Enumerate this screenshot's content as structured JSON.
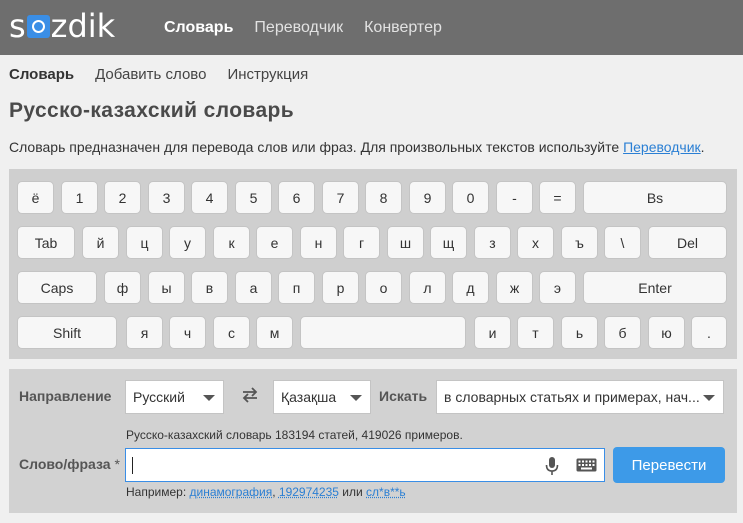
{
  "header": {
    "logo_text": "sozdik",
    "nav": [
      "Словарь",
      "Переводчик",
      "Конвертер"
    ]
  },
  "subnav": [
    "Словарь",
    "Добавить слово",
    "Инструкция"
  ],
  "page": {
    "title": "Русско-казахский словарь",
    "description": "Словарь предназначен для перевода слов или фраз. Для произвольных текстов используйте ",
    "description_link": "Переводчик",
    "description_end": "."
  },
  "keyboard": {
    "rows": [
      [
        "ё",
        "1",
        "2",
        "3",
        "4",
        "5",
        "6",
        "7",
        "8",
        "9",
        "0",
        "-",
        "=",
        "Bs"
      ],
      [
        "Tab",
        "й",
        "ц",
        "у",
        "к",
        "е",
        "н",
        "г",
        "ш",
        "щ",
        "з",
        "х",
        "ъ",
        "\\",
        "Del"
      ],
      [
        "Caps",
        "ф",
        "ы",
        "в",
        "а",
        "п",
        "р",
        "о",
        "л",
        "д",
        "ж",
        "э",
        "Enter"
      ],
      [
        "Shift",
        "я",
        "ч",
        "с",
        "м",
        "",
        "и",
        "т",
        "ь",
        "б",
        "ю",
        "."
      ]
    ]
  },
  "search": {
    "direction_label": "Направление",
    "from_lang": "Русский",
    "to_lang": "Қазақша",
    "search_label": "Искать",
    "search_scope": "в словарных статьях и примерах, нач...",
    "stats": "Русско-казахский словарь  183194 статей, 419026 примеров.",
    "phrase_label": "Слово/фраза",
    "required_mark": "*",
    "input_value": "",
    "button_label": "Перевести",
    "example_prefix": "Например: ",
    "examples": [
      "динамография",
      "192974235",
      "сл*в**ь"
    ],
    "example_sep1": ", ",
    "example_sep2": " или "
  },
  "colors": {
    "topbar": "#6e6e6e",
    "accent": "#3d9ae8",
    "link": "#2a7fd4"
  }
}
